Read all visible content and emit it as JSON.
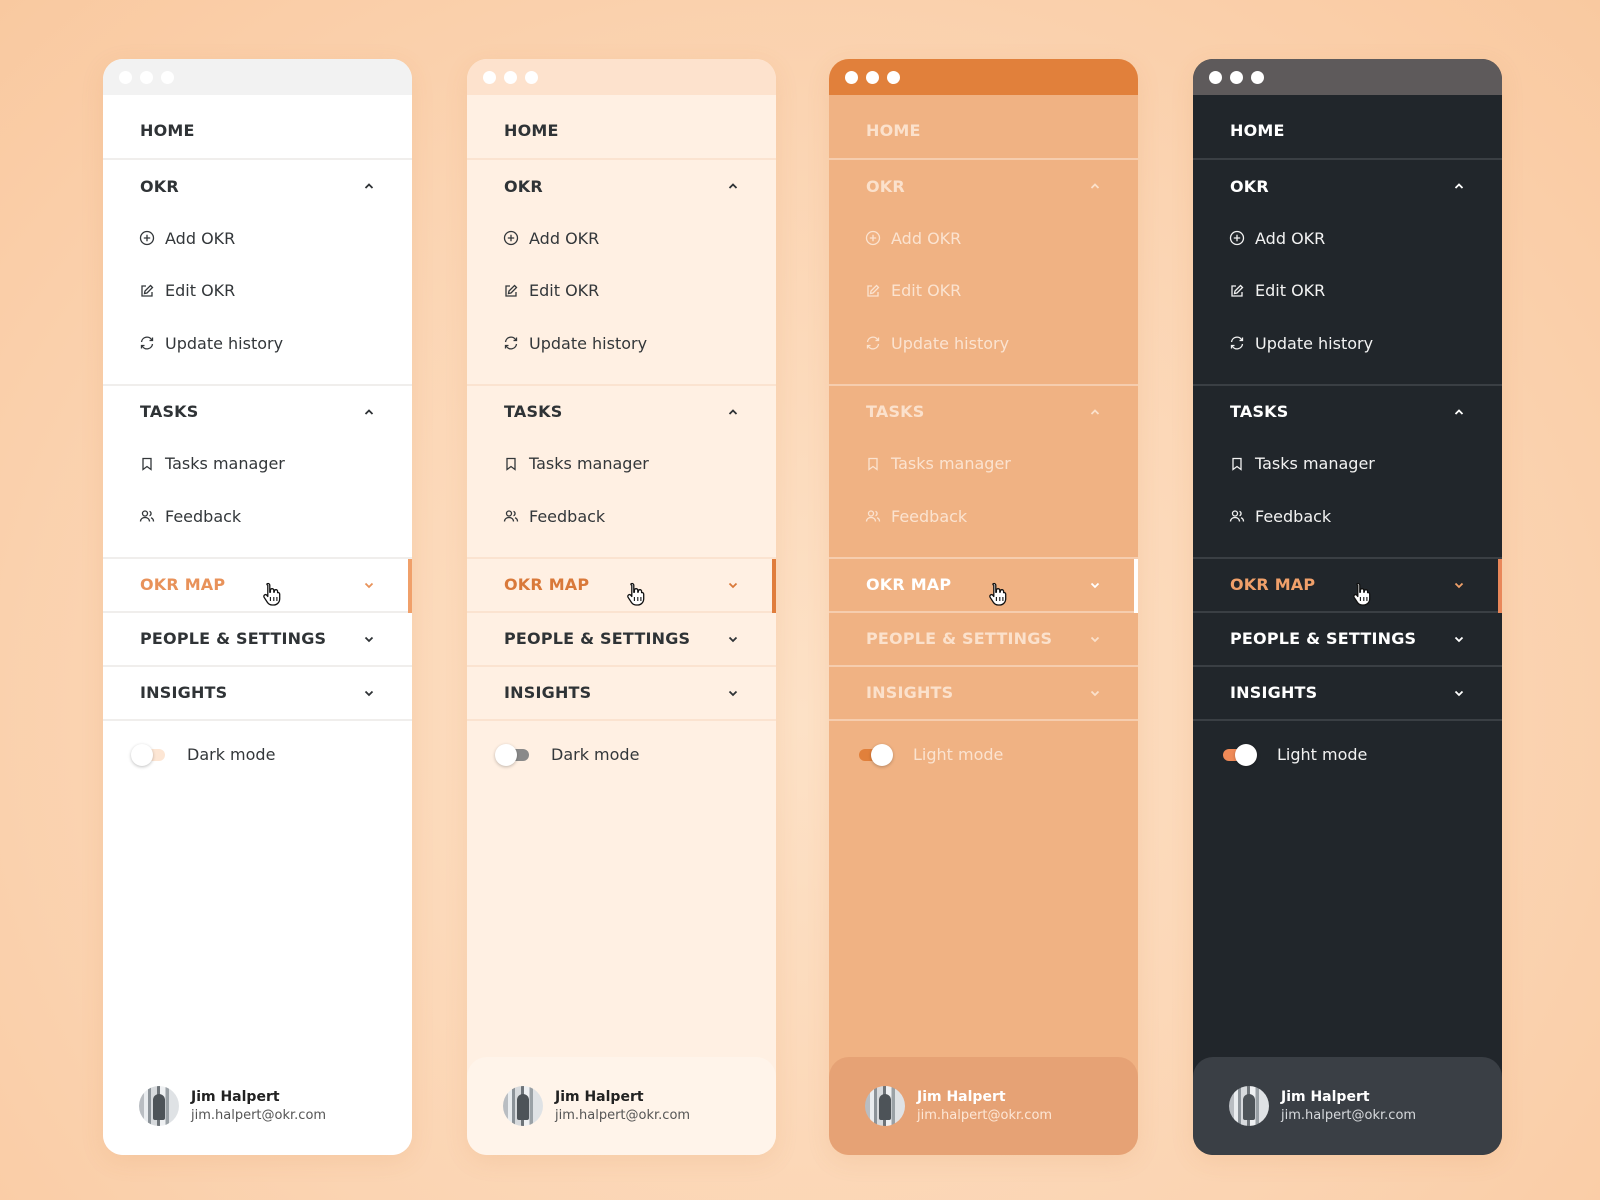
{
  "nav": {
    "home": "HOME",
    "okr": {
      "label": "OKR",
      "items": [
        {
          "label": "Add OKR",
          "icon": "plus-circle-icon"
        },
        {
          "label": "Edit OKR",
          "icon": "edit-icon"
        },
        {
          "label": "Update history",
          "icon": "refresh-icon"
        }
      ]
    },
    "tasks": {
      "label": "TASKS",
      "items": [
        {
          "label": "Tasks manager",
          "icon": "bookmark-icon"
        },
        {
          "label": "Feedback",
          "icon": "users-icon"
        }
      ]
    },
    "okr_map": "OKR MAP",
    "people_settings": "PEOPLE & SETTINGS",
    "insights": "INSIGHTS"
  },
  "user": {
    "name": "Jim Halpert",
    "email": "jim.halpert@okr.com"
  },
  "panels": [
    {
      "theme": "light",
      "toggle_label": "Dark mode",
      "toggle_on": false,
      "colors": {
        "bg": "#ffffff",
        "titlebar": "#f2f2f2",
        "dot": "#ffffff",
        "head": "#2f3336",
        "sub": "#33373a",
        "div": "#f0eeec",
        "active": "#e8925a",
        "active_bar": "#f0a06a",
        "track": "#fde6d4",
        "user_bg": "#ffffff",
        "uname": "#222",
        "umail": "#555"
      }
    },
    {
      "theme": "cream",
      "toggle_label": "Dark mode",
      "toggle_on": false,
      "colors": {
        "bg": "#fff0e3",
        "titlebar": "#fde2cd",
        "dot": "#ffffff",
        "head": "#2f3336",
        "sub": "#33373a",
        "div": "#fbe3d0",
        "active": "#d9793a",
        "active_bar": "#e07d3c",
        "track": "#8a8a8a",
        "user_bg": "#fff4ea",
        "uname": "#222",
        "umail": "#555"
      }
    },
    {
      "theme": "orange",
      "toggle_label": "Light mode",
      "toggle_on": true,
      "colors": {
        "bg": "#f0b283",
        "titlebar": "#e1803b",
        "dot": "#ffffff",
        "head": "#fbe1cc",
        "sub": "#fbe3d0",
        "div": "#f6cdae",
        "active": "#ffffff",
        "active_bar": "#ffffff",
        "track": "#e1803b",
        "user_bg": "#e6a275",
        "uname": "#ffffff",
        "umail": "#fde7d6"
      }
    },
    {
      "theme": "dark",
      "toggle_label": "Light mode",
      "toggle_on": true,
      "colors": {
        "bg": "#21262b",
        "titlebar": "#5e5a5b",
        "dot": "#ffffff",
        "head": "#ffffff",
        "sub": "#f2f2f2",
        "div": "#3a3f44",
        "active": "#f0a06a",
        "active_bar": "#e9875a",
        "track": "#ef8a58",
        "user_bg": "#3a3f45",
        "uname": "#ffffff",
        "umail": "#d7dadd"
      }
    }
  ]
}
